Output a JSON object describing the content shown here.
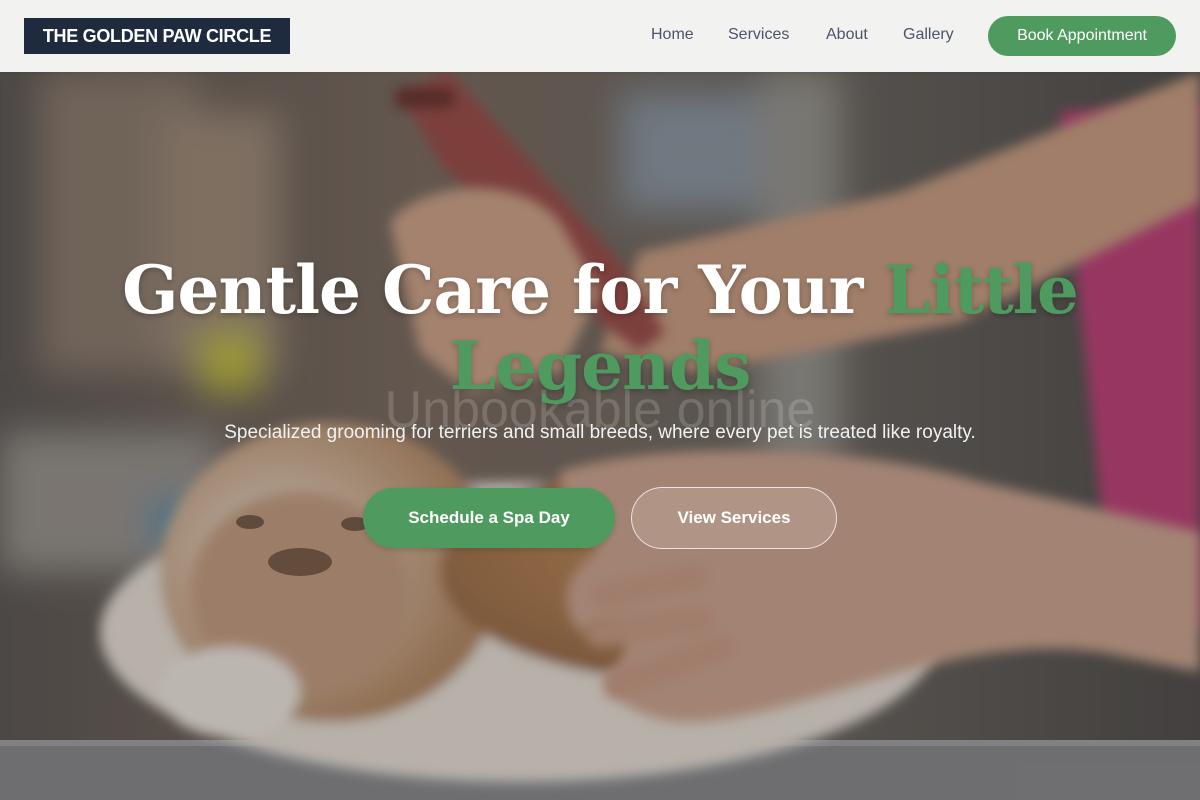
{
  "header": {
    "logo_text": "THE GOLDEN PAW CIRCLE",
    "nav": [
      {
        "label": "Home"
      },
      {
        "label": "Services"
      },
      {
        "label": "About"
      },
      {
        "label": "Gallery"
      }
    ],
    "cta_label": "Book Appointment"
  },
  "hero": {
    "headline_main": "Gentle Care for Your ",
    "headline_accent": "Little Legends",
    "ghost_text": "Unbookable online",
    "subtitle": "Specialized grooming for terriers and small breeds, where every pet is treated like royalty.",
    "primary_cta": "Schedule a Spa Day",
    "secondary_cta": "View Services"
  },
  "colors": {
    "accent_green": "#4f9a5e",
    "logo_bg": "#1e2a3e",
    "header_bg": "#f2f2f1",
    "nav_text": "#4a5566"
  }
}
